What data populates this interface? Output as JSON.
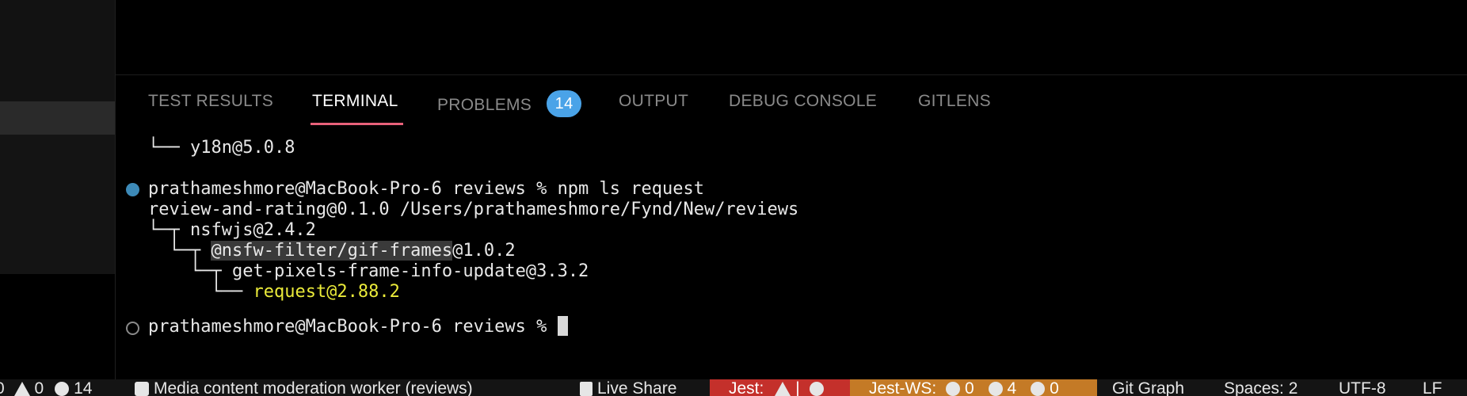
{
  "panel": {
    "tabs": [
      {
        "label": "TEST RESULTS"
      },
      {
        "label": "TERMINAL"
      },
      {
        "label": "PROBLEMS",
        "badge": "14"
      },
      {
        "label": "OUTPUT"
      },
      {
        "label": "DEBUG CONSOLE"
      },
      {
        "label": "GITLENS"
      }
    ],
    "active_tab": "TERMINAL",
    "accent_color": "#e8617a",
    "badge_color": "#4aa3e8"
  },
  "terminal": {
    "lines": [
      {
        "tree": "└── ",
        "text": "y18n@5.0.8"
      },
      {
        "prompt": "prathameshmore@MacBook-Pro-6 reviews % ",
        "command": "npm ls request"
      },
      {
        "text": "review-and-rating@0.1.0 /Users/prathameshmore/Fynd/New/reviews"
      },
      {
        "tree": "└─┬ ",
        "text": "nsfwjs@2.4.2"
      },
      {
        "tree": "└─┬ ",
        "highlight": "@nsfw-filter/gif-frames",
        "text": "@1.0.2"
      },
      {
        "tree": "└─┬ ",
        "text": "get-pixels-frame-info-update@3.3.2"
      },
      {
        "tree": "└── ",
        "text": "request@2.88.2"
      },
      {
        "prompt": "prathameshmore@MacBook-Pro-6 reviews % "
      }
    ]
  },
  "statusbar": {
    "errors": "0",
    "warnings": "0",
    "infos": "14",
    "task": "Media content moderation worker (reviews)",
    "live_share": "Live Share",
    "jest": "Jest:",
    "jest_ws": "Jest-WS:",
    "jest_ws_passed": "0",
    "jest_ws_failed": "4",
    "jest_ws_unknown": "0",
    "git_graph": "Git Graph",
    "spaces": "Spaces: 2",
    "encoding": "UTF-8",
    "eol": "LF",
    "jest_color": "#c4302b",
    "jest_ws_color": "#c47a26"
  }
}
